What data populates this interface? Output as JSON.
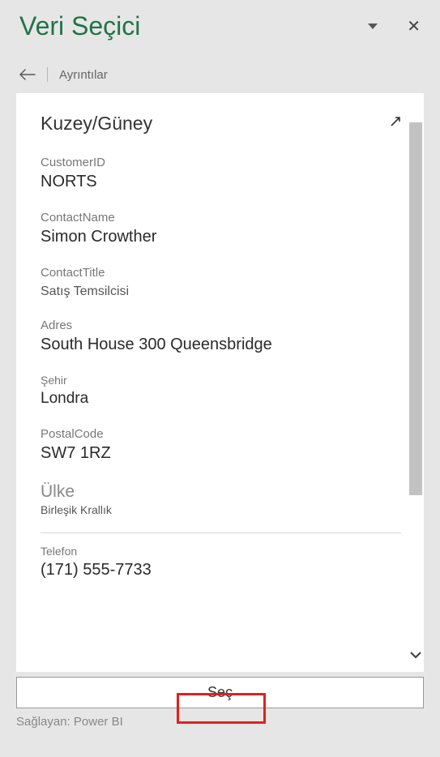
{
  "header": {
    "title": "Veri Seçici"
  },
  "breadcrumb": {
    "label": "Ayrıntılar"
  },
  "details": {
    "heading": "Kuzey/Güney",
    "fields": {
      "customer_id": {
        "label": "CustomerID",
        "value": "NORTS"
      },
      "contact_name": {
        "label": "ContactName",
        "value": "Simon Crowther"
      },
      "contact_title": {
        "label": "ContactTitle",
        "value": "Satış Temsilcisi"
      },
      "address": {
        "label": "Adres",
        "value": "South House 300 Queensbridge"
      },
      "city": {
        "label": "Şehir",
        "value": "Londra"
      },
      "postal_code": {
        "label": "PostalCode",
        "value": "SW7 1RZ"
      },
      "country": {
        "label": "Ülke",
        "value": "Birleşik Krallık"
      },
      "phone": {
        "label": "Telefon",
        "value": "(171) 555-7733"
      }
    }
  },
  "button": {
    "select": "Seç"
  },
  "footer": {
    "provider": "Sağlayan: Power BI"
  }
}
